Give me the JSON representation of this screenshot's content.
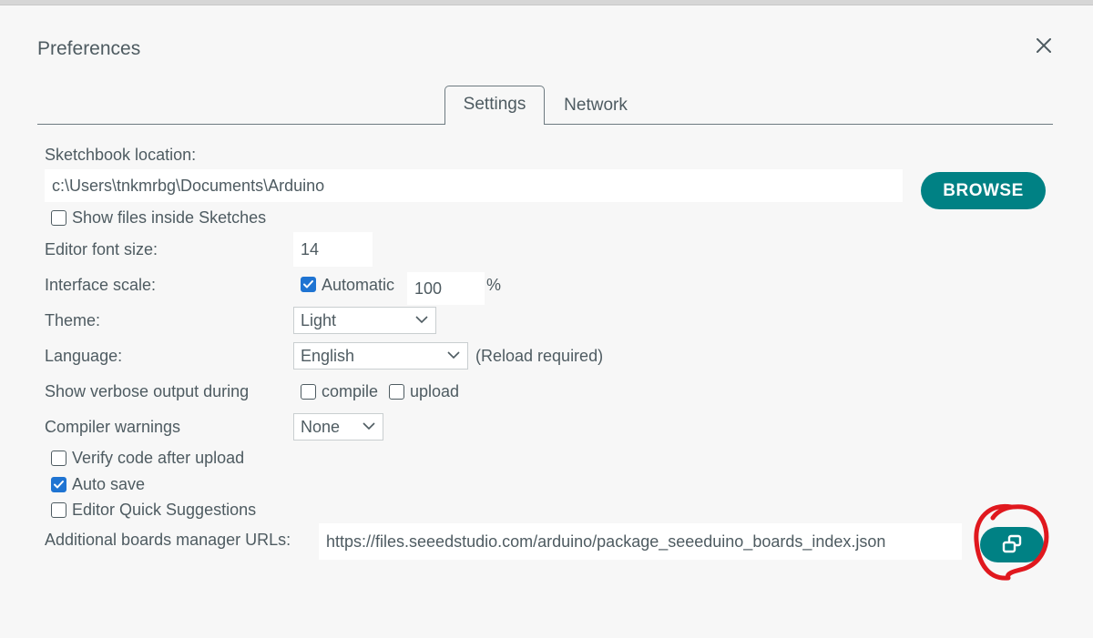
{
  "dialog": {
    "title": "Preferences",
    "close_icon": "close-icon"
  },
  "tabs": [
    {
      "label": "Settings",
      "active": true
    },
    {
      "label": "Network",
      "active": false
    }
  ],
  "sketchbook": {
    "label": "Sketchbook location:",
    "value": "c:\\Users\\tnkmrbg\\Documents\\Arduino",
    "browse_label": "BROWSE",
    "show_files_label": "Show files inside Sketches",
    "show_files_checked": false
  },
  "font_size": {
    "label": "Editor font size:",
    "value": "14"
  },
  "interface_scale": {
    "label": "Interface scale:",
    "automatic_label": "Automatic",
    "automatic_checked": true,
    "value": "100",
    "unit": "%"
  },
  "theme": {
    "label": "Theme:",
    "selected": "Light"
  },
  "language": {
    "label": "Language:",
    "selected": "English",
    "note": "(Reload required)"
  },
  "verbose": {
    "label": "Show verbose output during",
    "compile_label": "compile",
    "compile_checked": false,
    "upload_label": "upload",
    "upload_checked": false
  },
  "compiler_warnings": {
    "label": "Compiler warnings",
    "selected": "None"
  },
  "options": {
    "verify_label": "Verify code after upload",
    "verify_checked": false,
    "autosave_label": "Auto save",
    "autosave_checked": true,
    "quick_suggestions_label": "Editor Quick Suggestions",
    "quick_suggestions_checked": false
  },
  "boards_urls": {
    "label": "Additional boards manager URLs:",
    "value": "https://files.seeedstudio.com/arduino/package_seeeduino_boards_index.json",
    "button_icon": "open-window-icon"
  },
  "colors": {
    "accent": "#008184",
    "checkbox": "#1f74d2",
    "annotation": "#e0181e"
  }
}
